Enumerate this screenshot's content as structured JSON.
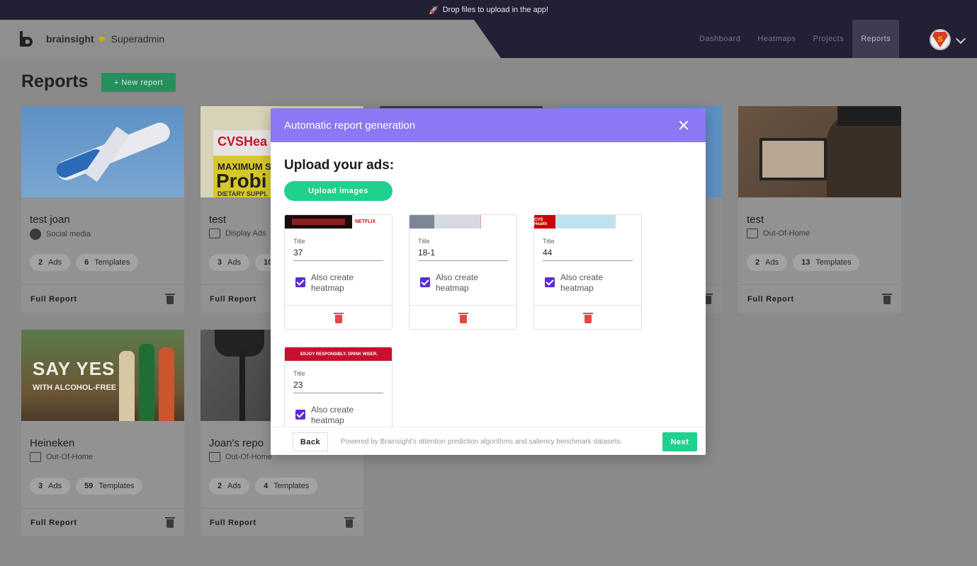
{
  "banner": {
    "text": "Drop files to upload in the app!",
    "icon": "rocket-icon"
  },
  "brand": {
    "name": "brainsight",
    "role": "Superadmin"
  },
  "nav": {
    "items": [
      "Dashboard",
      "Heatmaps",
      "Projects",
      "Reports"
    ],
    "active": "Reports"
  },
  "page": {
    "title": "Reports",
    "new_report_label": "+ New report"
  },
  "cards": [
    {
      "name": "test joan",
      "type": "Social media",
      "ads": "2",
      "ads_label": "Ads",
      "templates": "6",
      "templates_label": "Templates",
      "footer": "Full Report"
    },
    {
      "name": "test",
      "type": "Display Ads",
      "ads": "3",
      "ads_label": "Ads",
      "templates": "10",
      "templates_label": "",
      "footer": "Full Report"
    },
    {
      "name": "test",
      "type": "Out-Of-Home",
      "ads": "2",
      "ads_label": "Ads",
      "templates": "13",
      "templates_label": "Templates",
      "footer": "Full Report"
    },
    {
      "name": "Heineken",
      "type": "Out-Of-Home",
      "ads": "3",
      "ads_label": "Ads",
      "templates": "59",
      "templates_label": "Templates",
      "footer": "Full Report"
    },
    {
      "name": "Joan's repo",
      "type": "Out-Of-Home",
      "ads": "2",
      "ads_label": "Ads",
      "templates": "4",
      "templates_label": "Templates",
      "footer": "Full Report"
    }
  ],
  "card_image_text": {
    "cvs1": "CVSHea",
    "cvs2": "MAXIMUM S",
    "cvs3": "Probi",
    "cvs4": "DIETARY SUPPL",
    "say_yes": "SAY YES",
    "with": "WITH",
    "alcohol_free": "ALCOHOL-FREE"
  },
  "modal": {
    "title": "Automatic report generation",
    "upload_heading": "Upload your ads:",
    "upload_button": "Upload images",
    "ads": [
      {
        "title_label": "Title",
        "title_value": "37",
        "checkbox_label": "Also create heatmap",
        "checked": true
      },
      {
        "title_label": "Title",
        "title_value": "18-1",
        "checkbox_label": "Also create heatmap",
        "checked": true
      },
      {
        "title_label": "Title",
        "title_value": "44",
        "checkbox_label": "Also create heatmap",
        "checked": true
      },
      {
        "title_label": "Title",
        "title_value": "23",
        "checkbox_label": "Also create heatmap",
        "checked": true
      }
    ],
    "back_label": "Back",
    "powered_text": "Powered by Brainsight's attention prediction algorithms and saliency benchmark datasets.",
    "next_label": "Next",
    "thumb_text": {
      "netflix": "NETFLIX",
      "cvs": "CVS Health",
      "budweiser": "ENJOY RESPONSIBLY. DRINK WISER."
    }
  },
  "colors": {
    "modal_header": "#8a79f3",
    "accent_green": "#1fd18c",
    "checkbox": "#5b2bd6",
    "delete_red": "#e84646",
    "navbar": "#232035"
  }
}
